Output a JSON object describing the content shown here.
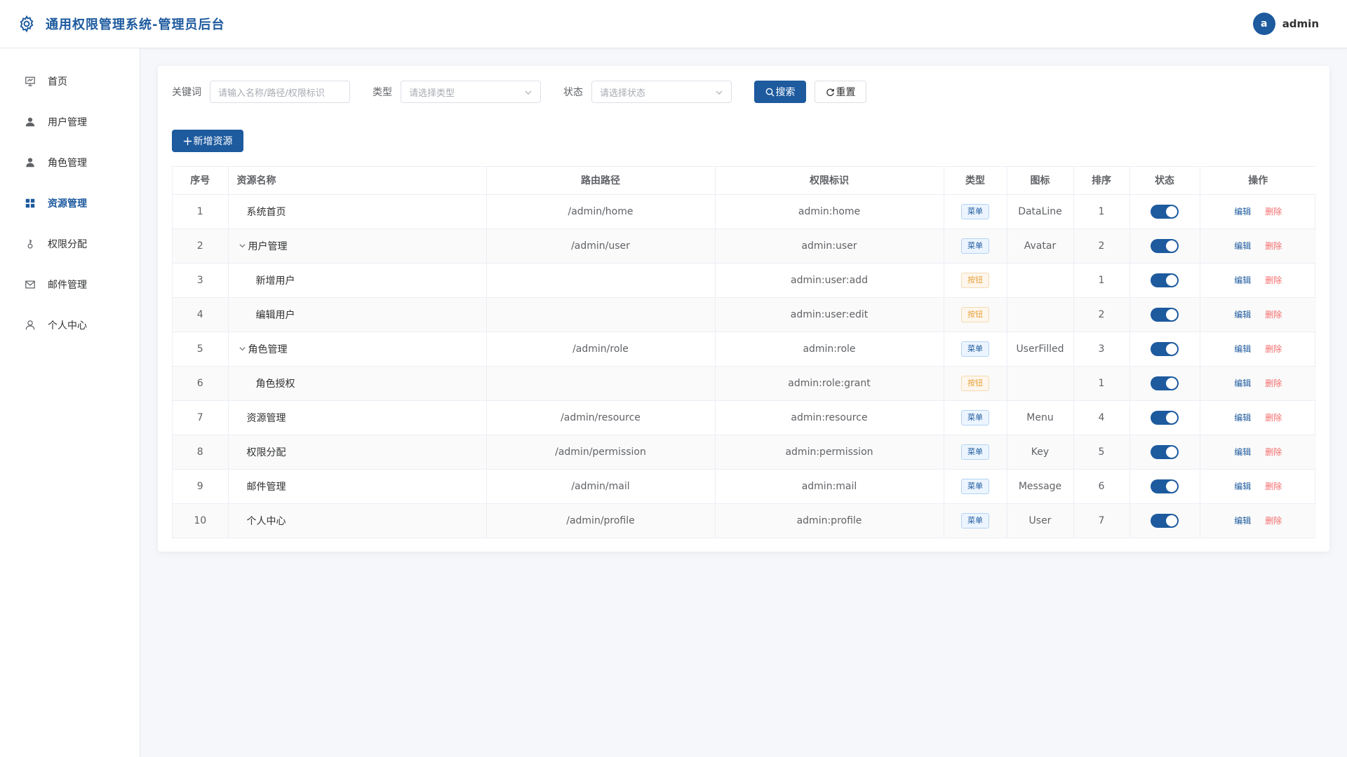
{
  "header": {
    "title": "通用权限管理系统-管理员后台",
    "avatar_letter": "a",
    "username": "admin",
    "brand_icon": "gear-icon"
  },
  "sidebar": {
    "items": [
      {
        "label": "首页",
        "icon": "presentation-chart-icon",
        "active": false
      },
      {
        "label": "用户管理",
        "icon": "user-icon",
        "active": false
      },
      {
        "label": "角色管理",
        "icon": "user-filled-icon",
        "active": false
      },
      {
        "label": "资源管理",
        "icon": "grid-menu-icon",
        "active": true
      },
      {
        "label": "权限分配",
        "icon": "key-icon",
        "active": false
      },
      {
        "label": "邮件管理",
        "icon": "mail-icon",
        "active": false
      },
      {
        "label": "个人中心",
        "icon": "user-outline-icon",
        "active": false
      }
    ]
  },
  "filters": {
    "keyword_label": "关键词",
    "keyword_placeholder": "请输入名称/路径/权限标识",
    "type_label": "类型",
    "type_placeholder": "请选择类型",
    "status_label": "状态",
    "status_placeholder": "请选择状态",
    "search_label": "搜索",
    "reset_label": "重置"
  },
  "toolbar": {
    "add_label": "新增资源"
  },
  "table": {
    "columns": [
      "序号",
      "资源名称",
      "路由路径",
      "权限标识",
      "类型",
      "图标",
      "排序",
      "状态",
      "操作"
    ],
    "edit_label": "编辑",
    "delete_label": "删除",
    "rows": [
      {
        "index": "1",
        "name": "系统首页",
        "level": 0,
        "expandable": false,
        "path": "/admin/home",
        "perm": "admin:home",
        "type": "菜单",
        "type_kind": "menu",
        "icon": "DataLine",
        "sort": "1",
        "enabled": true
      },
      {
        "index": "2",
        "name": "用户管理",
        "level": 0,
        "expandable": true,
        "path": "/admin/user",
        "perm": "admin:user",
        "type": "菜单",
        "type_kind": "menu",
        "icon": "Avatar",
        "sort": "2",
        "enabled": true
      },
      {
        "index": "3",
        "name": "新增用户",
        "level": 1,
        "expandable": false,
        "path": "",
        "perm": "admin:user:add",
        "type": "按钮",
        "type_kind": "button",
        "icon": "",
        "sort": "1",
        "enabled": true
      },
      {
        "index": "4",
        "name": "编辑用户",
        "level": 1,
        "expandable": false,
        "path": "",
        "perm": "admin:user:edit",
        "type": "按钮",
        "type_kind": "button",
        "icon": "",
        "sort": "2",
        "enabled": true
      },
      {
        "index": "5",
        "name": "角色管理",
        "level": 0,
        "expandable": true,
        "path": "/admin/role",
        "perm": "admin:role",
        "type": "菜单",
        "type_kind": "menu",
        "icon": "UserFilled",
        "sort": "3",
        "enabled": true
      },
      {
        "index": "6",
        "name": "角色授权",
        "level": 1,
        "expandable": false,
        "path": "",
        "perm": "admin:role:grant",
        "type": "按钮",
        "type_kind": "button",
        "icon": "",
        "sort": "1",
        "enabled": true
      },
      {
        "index": "7",
        "name": "资源管理",
        "level": 0,
        "expandable": false,
        "path": "/admin/resource",
        "perm": "admin:resource",
        "type": "菜单",
        "type_kind": "menu",
        "icon": "Menu",
        "sort": "4",
        "enabled": true
      },
      {
        "index": "8",
        "name": "权限分配",
        "level": 0,
        "expandable": false,
        "path": "/admin/permission",
        "perm": "admin:permission",
        "type": "菜单",
        "type_kind": "menu",
        "icon": "Key",
        "sort": "5",
        "enabled": true
      },
      {
        "index": "9",
        "name": "邮件管理",
        "level": 0,
        "expandable": false,
        "path": "/admin/mail",
        "perm": "admin:mail",
        "type": "菜单",
        "type_kind": "menu",
        "icon": "Message",
        "sort": "6",
        "enabled": true
      },
      {
        "index": "10",
        "name": "个人中心",
        "level": 0,
        "expandable": false,
        "path": "/admin/profile",
        "perm": "admin:profile",
        "type": "菜单",
        "type_kind": "menu",
        "icon": "User",
        "sort": "7",
        "enabled": true
      }
    ]
  },
  "colors": {
    "primary": "#1d5a9e",
    "danger": "#f56c6c",
    "warning": "#e6a23c"
  }
}
